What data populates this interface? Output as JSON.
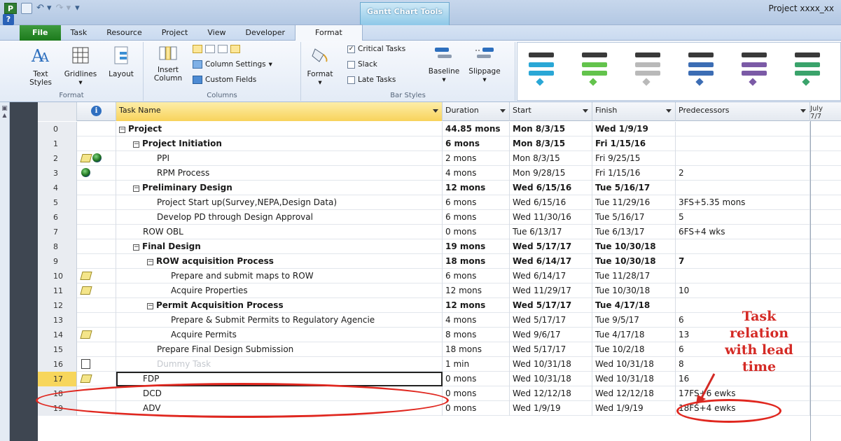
{
  "window": {
    "title": "Project xxxx_xx",
    "contextual_tab_group": "Gantt Chart Tools"
  },
  "tabs": [
    "File",
    "Task",
    "Resource",
    "Project",
    "View",
    "Developer",
    "Format"
  ],
  "active_tab": "Format",
  "ribbon": {
    "format_group": {
      "label": "Format",
      "text_styles": "Text Styles",
      "gridlines": "Gridlines",
      "layout": "Layout"
    },
    "columns_group": {
      "label": "Columns",
      "insert_column": "Insert Column",
      "column_settings": "Column Settings",
      "custom_fields": "Custom Fields"
    },
    "bar_styles_group": {
      "label": "Bar Styles",
      "format": "Format",
      "critical_tasks": "Critical Tasks",
      "critical_tasks_checked": true,
      "slack": "Slack",
      "late_tasks": "Late Tasks",
      "baseline": "Baseline",
      "slippage": "Slippage"
    },
    "gallery_colors": [
      "#2aa7d6",
      "#63c34c",
      "#b9b9b9",
      "#3c6db4",
      "#7b5aa6",
      "#3aa36b"
    ]
  },
  "columns": {
    "task_name": "Task Name",
    "duration": "Duration",
    "start": "Start",
    "finish": "Finish",
    "predecessors": "Predecessors"
  },
  "gantt_header": {
    "month": "July",
    "week": "7/7"
  },
  "rows": [
    {
      "id": "0",
      "name": "Project",
      "duration": "44.85 mons",
      "start": "Mon 8/3/15",
      "finish": "Wed 1/9/19",
      "pred": ""
    },
    {
      "id": "1",
      "name": "Project Initiation",
      "duration": "6 mons",
      "start": "Mon 8/3/15",
      "finish": "Fri 1/15/16",
      "pred": ""
    },
    {
      "id": "2",
      "name": "PPI",
      "duration": "2 mons",
      "start": "Mon 8/3/15",
      "finish": "Fri 9/25/15",
      "pred": ""
    },
    {
      "id": "3",
      "name": "RPM Process",
      "duration": "4 mons",
      "start": "Mon 9/28/15",
      "finish": "Fri 1/15/16",
      "pred": "2"
    },
    {
      "id": "4",
      "name": "Preliminary Design",
      "duration": "12 mons",
      "start": "Wed 6/15/16",
      "finish": "Tue 5/16/17",
      "pred": ""
    },
    {
      "id": "5",
      "name": "Project Start up(Survey,NEPA,Design Data)",
      "duration": "6 mons",
      "start": "Wed 6/15/16",
      "finish": "Tue 11/29/16",
      "pred": "3FS+5.35 mons"
    },
    {
      "id": "6",
      "name": "Develop PD through Design Approval",
      "duration": "6 mons",
      "start": "Wed 11/30/16",
      "finish": "Tue 5/16/17",
      "pred": "5"
    },
    {
      "id": "7",
      "name": "ROW OBL",
      "duration": "0 mons",
      "start": "Tue 6/13/17",
      "finish": "Tue 6/13/17",
      "pred": "6FS+4 wks"
    },
    {
      "id": "8",
      "name": "Final Design",
      "duration": "19 mons",
      "start": "Wed 5/17/17",
      "finish": "Tue 10/30/18",
      "pred": ""
    },
    {
      "id": "9",
      "name": "ROW acquisition Process",
      "duration": "18 mons",
      "start": "Wed 6/14/17",
      "finish": "Tue 10/30/18",
      "pred": "7"
    },
    {
      "id": "10",
      "name": "Prepare and submit maps to ROW",
      "duration": "6 mons",
      "start": "Wed 6/14/17",
      "finish": "Tue 11/28/17",
      "pred": ""
    },
    {
      "id": "11",
      "name": "Acquire Properties",
      "duration": "12 mons",
      "start": "Wed 11/29/17",
      "finish": "Tue 10/30/18",
      "pred": "10"
    },
    {
      "id": "12",
      "name": "Permit Acquisition Process",
      "duration": "12 mons",
      "start": "Wed 5/17/17",
      "finish": "Tue 4/17/18",
      "pred": ""
    },
    {
      "id": "13",
      "name": "Prepare & Submit Permits to Regulatory Agencie",
      "duration": "4 mons",
      "start": "Wed 5/17/17",
      "finish": "Tue 9/5/17",
      "pred": "6"
    },
    {
      "id": "14",
      "name": "Acquire Permits",
      "duration": "8 mons",
      "start": "Wed 9/6/17",
      "finish": "Tue 4/17/18",
      "pred": "13"
    },
    {
      "id": "15",
      "name": "Prepare Final Design Submission",
      "duration": "18 mons",
      "start": "Wed 5/17/17",
      "finish": "Tue 10/2/18",
      "pred": "6"
    },
    {
      "id": "16",
      "name": "Dummy Task",
      "duration": "1 min",
      "start": "Wed 10/31/18",
      "finish": "Wed 10/31/18",
      "pred": "8"
    },
    {
      "id": "17",
      "name": "FDP",
      "duration": "0 mons",
      "start": "Wed 10/31/18",
      "finish": "Wed 10/31/18",
      "pred": "16"
    },
    {
      "id": "18",
      "name": "DCD",
      "duration": "0 mons",
      "start": "Wed 12/12/18",
      "finish": "Wed 12/12/18",
      "pred": "17FS+6 ewks"
    },
    {
      "id": "19",
      "name": "ADV",
      "duration": "0 mons",
      "start": "Wed 1/9/19",
      "finish": "Wed 1/9/19",
      "pred": "18FS+4 ewks"
    }
  ],
  "annotation": {
    "line1": "Task",
    "line2": "relation",
    "line3": "with lead",
    "line4": "time",
    "color": "#d42a25"
  }
}
